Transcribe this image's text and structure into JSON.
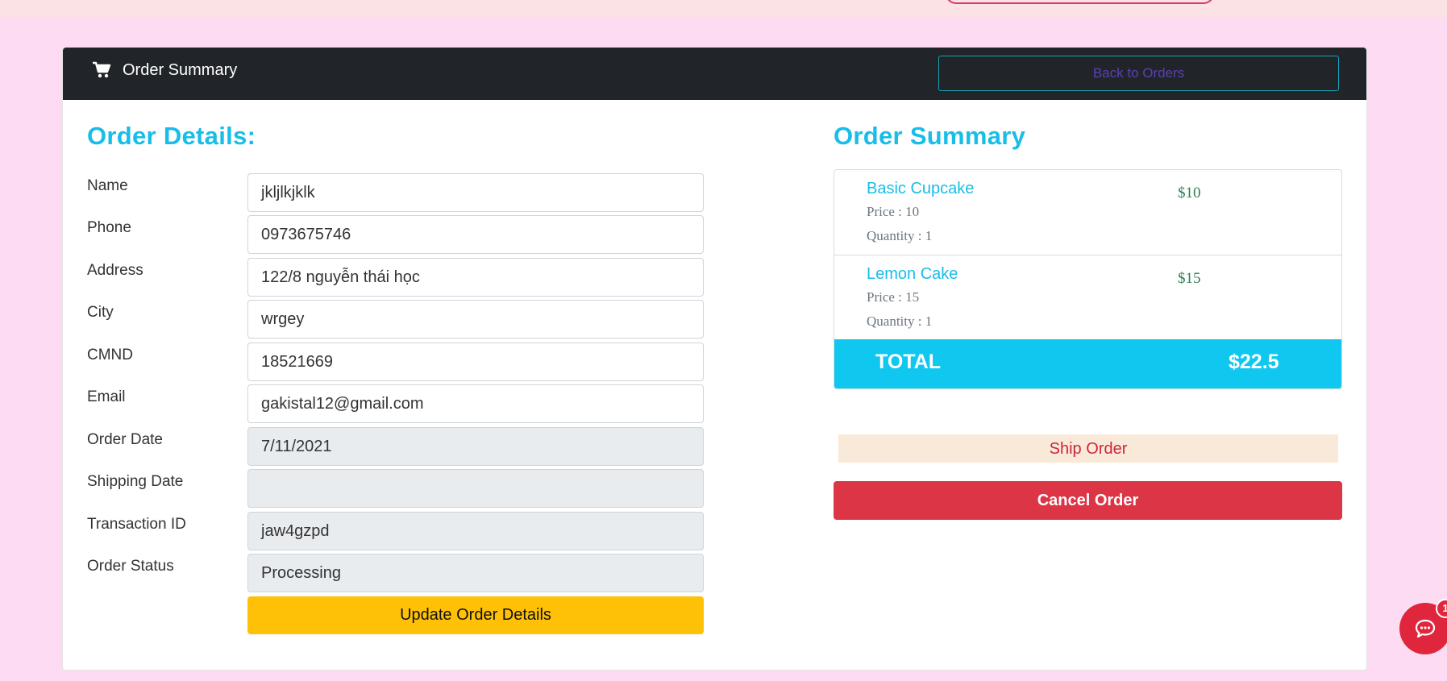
{
  "header": {
    "title": "Order Summary",
    "back_label": "Back to Orders"
  },
  "details": {
    "heading": "Order Details:",
    "fields": [
      {
        "label": "Name",
        "value": "jkljlkjklk"
      },
      {
        "label": "Phone",
        "value": "0973675746"
      },
      {
        "label": "Address",
        "value": "122/8 nguyễn thái học"
      },
      {
        "label": "City",
        "value": "wrgey"
      },
      {
        "label": "CMND",
        "value": "18521669"
      },
      {
        "label": "Email",
        "value": "gakistal12@gmail.com"
      },
      {
        "label": "Order Date",
        "value": "7/11/2021"
      },
      {
        "label": "Shipping Date",
        "value": ""
      },
      {
        "label": "Transaction ID",
        "value": "jaw4gzpd"
      },
      {
        "label": "Order Status",
        "value": "Processing"
      }
    ],
    "update_label": "Update Order Details"
  },
  "summary": {
    "heading": "Order Summary",
    "items": [
      {
        "name": "Basic Cupcake",
        "price_line": "Price : 10",
        "qty_line": "Quantity : 1",
        "amount": "$10"
      },
      {
        "name": "Lemon Cake",
        "price_line": "Price : 15",
        "qty_line": "Quantity : 1",
        "amount": "$15"
      }
    ],
    "total_label": "TOTAL",
    "total_value": "$22.5"
  },
  "actions": {
    "ship_label": "Ship Order",
    "cancel_label": "Cancel Order"
  },
  "chat": {
    "badge": "1"
  },
  "colors": {
    "page_bg": "#fddcf3",
    "header_bg": "#212529",
    "accent": "#18bde8",
    "warning": "#ffc107",
    "danger": "#dc3545"
  }
}
